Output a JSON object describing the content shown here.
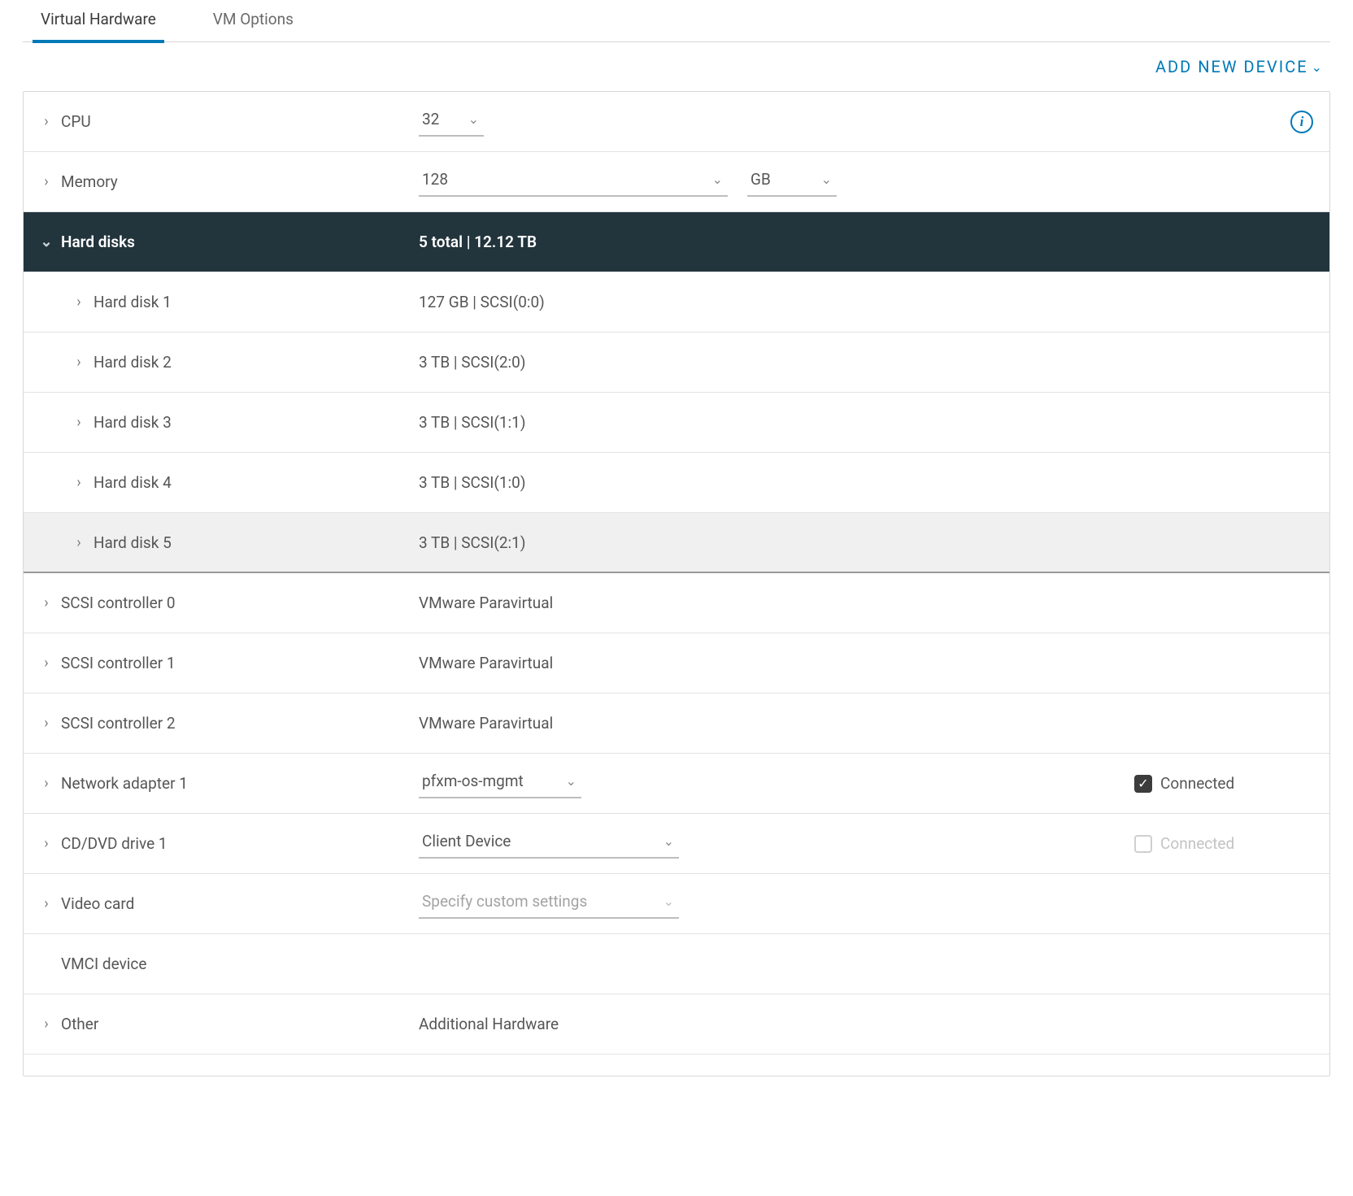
{
  "tabs": {
    "virtual_hardware": "Virtual Hardware",
    "vm_options": "VM Options"
  },
  "add_new_device": "ADD NEW DEVICE",
  "rows": {
    "cpu": {
      "label": "CPU",
      "value": "32"
    },
    "memory": {
      "label": "Memory",
      "value": "128",
      "unit": "GB"
    },
    "hard_disks": {
      "label": "Hard disks",
      "summary": "5 total | 12.12 TB"
    },
    "hd": [
      {
        "label": "Hard disk 1",
        "value": "127 GB | SCSI(0:0)"
      },
      {
        "label": "Hard disk 2",
        "value": "3 TB | SCSI(2:0)"
      },
      {
        "label": "Hard disk 3",
        "value": "3 TB | SCSI(1:1)"
      },
      {
        "label": "Hard disk 4",
        "value": "3 TB | SCSI(1:0)"
      },
      {
        "label": "Hard disk 5",
        "value": "3 TB | SCSI(2:1)"
      }
    ],
    "scsi": [
      {
        "label": "SCSI controller 0",
        "value": "VMware Paravirtual"
      },
      {
        "label": "SCSI controller 1",
        "value": "VMware Paravirtual"
      },
      {
        "label": "SCSI controller 2",
        "value": "VMware Paravirtual"
      }
    ],
    "network": {
      "label": "Network adapter 1",
      "value": "pfxm-os-mgmt",
      "connected": "Connected"
    },
    "cddvd": {
      "label": "CD/DVD drive 1",
      "value": "Client Device",
      "connected": "Connected"
    },
    "video": {
      "label": "Video card",
      "value": "Specify custom settings"
    },
    "vmci": {
      "label": "VMCI device"
    },
    "other": {
      "label": "Other",
      "value": "Additional Hardware"
    }
  },
  "icons": {
    "caret_right": "›",
    "caret_down": "⌄",
    "chev_down": "⌄",
    "info": "i",
    "check": "✓"
  }
}
